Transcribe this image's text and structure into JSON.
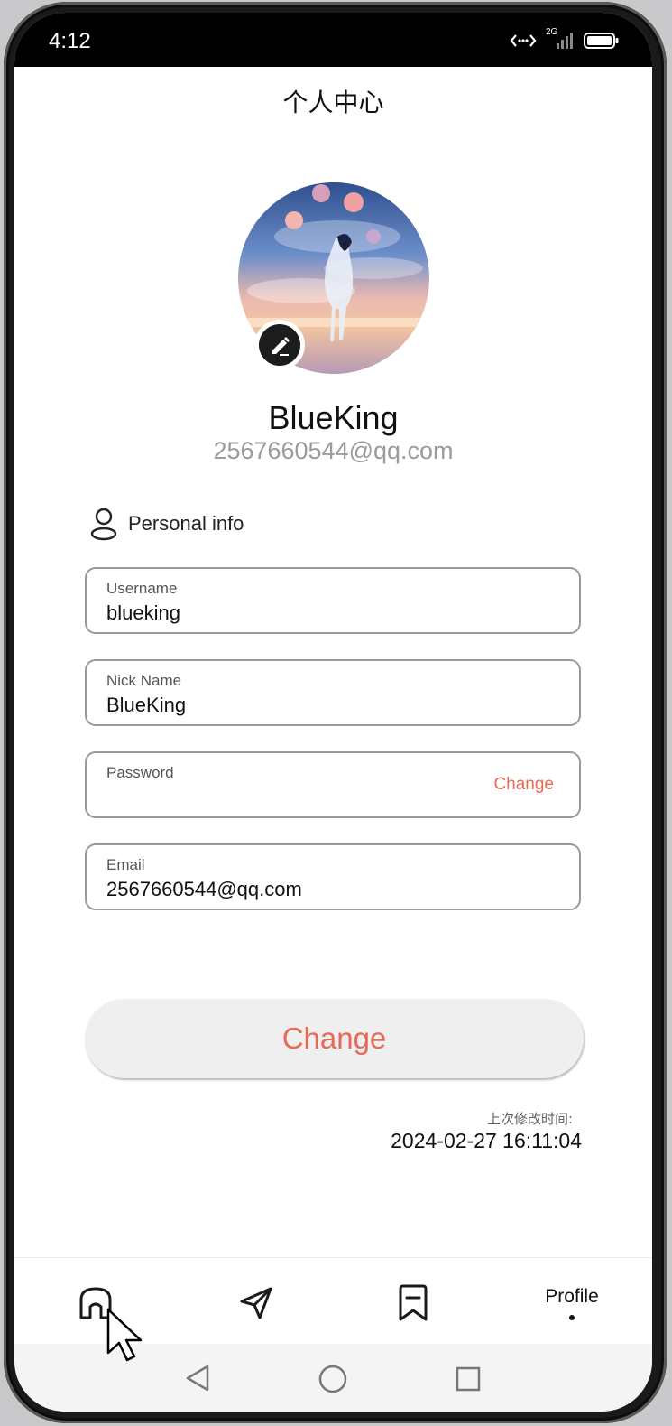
{
  "status_bar": {
    "time": "4:12",
    "network": "2G"
  },
  "header": {
    "title": "个人中心"
  },
  "profile": {
    "display_name": "BlueKing",
    "display_email": "2567660544@qq.com"
  },
  "section": {
    "title": "Personal info"
  },
  "fields": [
    {
      "label": "Username",
      "value": "blueking"
    },
    {
      "label": "Nick Name",
      "value": "BlueKing"
    },
    {
      "label": "Password",
      "value": "",
      "action": "Change"
    },
    {
      "label": "Email",
      "value": "2567660544@qq.com"
    }
  ],
  "submit": {
    "label": "Change"
  },
  "last_modified": {
    "label": "上次修改时间:",
    "value": "2024-02-27 16:11:04"
  },
  "tabs": [
    {
      "icon": "home-icon"
    },
    {
      "icon": "send-icon"
    },
    {
      "icon": "bookmark-icon"
    },
    {
      "label": "Profile"
    }
  ],
  "colors": {
    "accent": "#e46c57",
    "text": "#111111",
    "muted": "#9b9b9b",
    "border": "#9a9a9a"
  }
}
